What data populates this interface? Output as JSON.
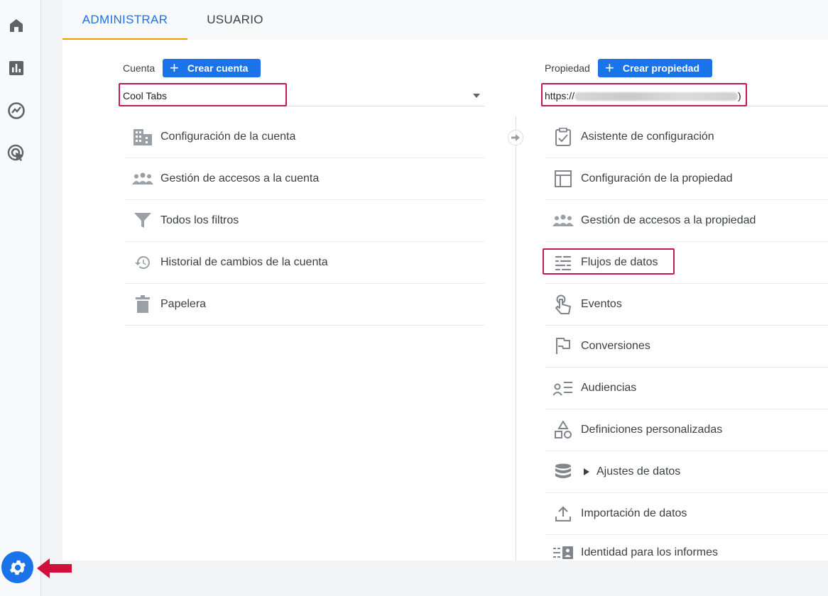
{
  "tabs": [
    {
      "label": "ADMINISTRAR",
      "active": true
    },
    {
      "label": "USUARIO",
      "active": false
    }
  ],
  "sidebar": {
    "items": [
      {
        "icon": "home-icon"
      },
      {
        "icon": "reports-icon"
      },
      {
        "icon": "explore-icon"
      },
      {
        "icon": "advertising-icon"
      }
    ],
    "admin_icon": "gear-icon"
  },
  "account": {
    "label": "Cuenta",
    "create_label": "Crear cuenta",
    "selected": "Cool Tabs",
    "items": [
      {
        "icon": "building-icon",
        "label": "Configuración de la cuenta"
      },
      {
        "icon": "people-icon",
        "label": "Gestión de accesos a la cuenta"
      },
      {
        "icon": "filter-icon",
        "label": "Todos los filtros"
      },
      {
        "icon": "history-icon",
        "label": "Historial de cambios de la cuenta"
      },
      {
        "icon": "trash-icon",
        "label": "Papelera"
      }
    ]
  },
  "property": {
    "label": "Propiedad",
    "create_label": "Crear propiedad",
    "selected_prefix": "https://",
    "selected_suffix": ")",
    "items": [
      {
        "icon": "checklist-icon",
        "label": "Asistente de configuración"
      },
      {
        "icon": "layout-icon",
        "label": "Configuración de la propiedad"
      },
      {
        "icon": "people-icon",
        "label": "Gestión de accesos a la propiedad"
      },
      {
        "icon": "streams-icon",
        "label": "Flujos de datos"
      },
      {
        "icon": "touch-icon",
        "label": "Eventos"
      },
      {
        "icon": "flag-icon",
        "label": "Conversiones"
      },
      {
        "icon": "audience-icon",
        "label": "Audiencias"
      },
      {
        "icon": "shapes-icon",
        "label": "Definiciones personalizadas"
      },
      {
        "icon": "database-icon",
        "label": "Ajustes de datos"
      },
      {
        "icon": "upload-icon",
        "label": "Importación de datos"
      },
      {
        "icon": "identity-icon",
        "label": "Identidad para los informes"
      }
    ]
  },
  "colors": {
    "accent": "#1a73e8",
    "highlight": "#c2185b",
    "tab_underline": "#f29900"
  }
}
